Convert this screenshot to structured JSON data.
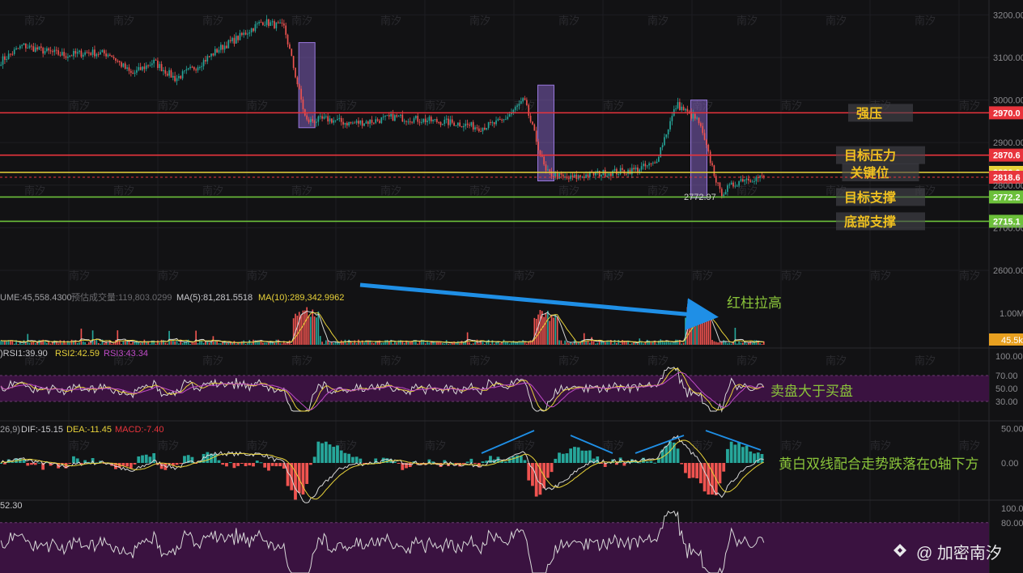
{
  "chart_data": [
    {
      "type": "candlestick",
      "panel": "price",
      "y_ticks": [
        "3200.00",
        "3100.00",
        "3000.00",
        "2900.00",
        "2800.00",
        "2700.00",
        "2600.00"
      ],
      "ylim": [
        2560,
        3235
      ],
      "close_approx": [
        3092,
        3128,
        3115,
        3105,
        3112,
        3108,
        3060,
        3090,
        3050,
        3080,
        3120,
        3150,
        3185,
        3170,
        2950,
        2955,
        2945,
        2950,
        2960,
        2955,
        2950,
        2945,
        2935,
        2950,
        3000,
        2830,
        2815,
        2825,
        2830,
        2835,
        2850,
        2990,
        2950,
        2780,
        2815,
        2818
      ],
      "price_labels": [
        {
          "name": "强压",
          "value": 2970.0,
          "label": "2970.0",
          "color": "#e8343c"
        },
        {
          "name": "目标压力",
          "value": 2870.6,
          "label": "2870.6",
          "color": "#e8343c"
        },
        {
          "name": "关键位",
          "value": 2830.0,
          "label": "2830.0",
          "color": "#e8d23a"
        },
        {
          "name": "current",
          "value": 2818.6,
          "label": "2818.6",
          "color": "#e8343c"
        },
        {
          "name": "目标支撑",
          "value": 2772.2,
          "label": "2772.2",
          "color": "#6cc03a"
        },
        {
          "name": "底部支撑",
          "value": 2715.1,
          "label": "2715.1",
          "color": "#6cc03a"
        }
      ],
      "low_annotation": {
        "label": "2772.97",
        "value": 2772.97
      },
      "highlight_boxes": [
        {
          "from_index": 14,
          "to_index": 14,
          "low": 2935,
          "high": 3135
        },
        {
          "from_index": 25,
          "to_index": 25,
          "low": 2810,
          "high": 3035
        },
        {
          "from_index": 32,
          "to_index": 32,
          "low": 2770,
          "high": 3000
        }
      ]
    },
    {
      "type": "bar",
      "panel": "volume",
      "legend": {
        "vol": "UME:45,558.4300",
        "pred": "预估成交量:119,803.0299",
        "ma5": "MA(5):81,281.5518",
        "ma10": "MA(10):289,342.9962"
      },
      "y_ticks": [
        "1.00M"
      ],
      "last_label": "45.5k",
      "annotation": "红柱拉高"
    },
    {
      "type": "line",
      "panel": "rsi",
      "legend": {
        "rsi1": ")RSI1:39.90",
        "rsi2": "RSI2:42.59",
        "rsi3": "RSI3:43.34"
      },
      "y_ticks": [
        "100.00",
        "70.00",
        "50.00",
        "30.00"
      ],
      "annotation": "卖盘大于买盘"
    },
    {
      "type": "bar",
      "panel": "macd",
      "legend": {
        "params": "26,9)",
        "dif": "DIF:-15.15",
        "dea": "DEA:-11.45",
        "macd": "MACD:-7.40"
      },
      "y_ticks": [
        "50.00",
        "0.00"
      ],
      "annotation": "黄白双线配合走势跌落在0轴下方"
    },
    {
      "type": "line",
      "panel": "kdj",
      "legend": {
        "value": "52.30"
      },
      "y_ticks": [
        "100.00",
        "80.00"
      ]
    }
  ],
  "watermark": {
    "text": "南汐",
    "brand": "@ 加密南汐"
  },
  "colors": {
    "up": "#26a69a",
    "down": "#ef5350",
    "white_line": "#d8d8d8",
    "yellow_line": "#e8d23a",
    "magenta_line": "#c04cc8",
    "band": "#3a1240",
    "arrow": "#1f8fe6",
    "annotation_green": "#8ac43a",
    "label_gold": "#f0c020"
  }
}
